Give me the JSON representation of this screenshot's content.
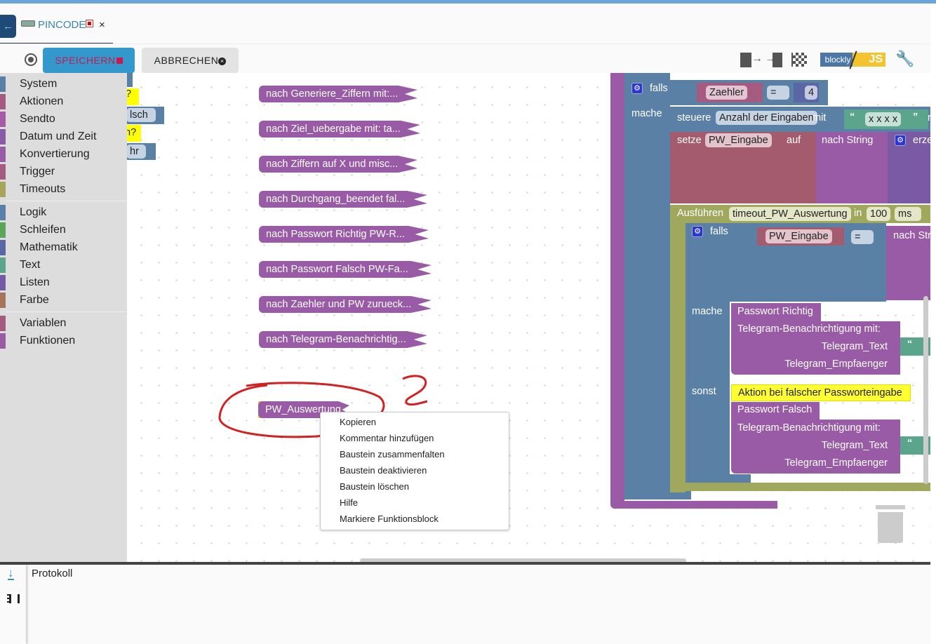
{
  "tab": {
    "title": "PINCODE",
    "close": "×",
    "logo": "blockly"
  },
  "toolbar": {
    "save_label": "SPEICHERN",
    "cancel_label": "ABBRECHEN",
    "mode_left": "blockly",
    "mode_right": "JS"
  },
  "toolbox": {
    "groups": [
      [
        {
          "label": "System",
          "color": "#5b80a5"
        },
        {
          "label": "Aktionen",
          "color": "#a55b80"
        },
        {
          "label": "Sendto",
          "color": "#a55ba5"
        },
        {
          "label": "Datum und Zeit",
          "color": "#8a5ba5"
        },
        {
          "label": "Konvertierung",
          "color": "#995ba5"
        },
        {
          "label": "Trigger",
          "color": "#a55b80"
        },
        {
          "label": "Timeouts",
          "color": "#a5a55b"
        }
      ],
      [
        {
          "label": "Logik",
          "color": "#5b80a5"
        },
        {
          "label": "Schleifen",
          "color": "#5ba55b"
        },
        {
          "label": "Mathematik",
          "color": "#5b67a5"
        },
        {
          "label": "Text",
          "color": "#5ba58c"
        },
        {
          "label": "Listen",
          "color": "#745ba5"
        },
        {
          "label": "Farbe",
          "color": "#a5745b"
        }
      ],
      [
        {
          "label": "Variablen",
          "color": "#a55b80"
        },
        {
          "label": "Funktionen",
          "color": "#995ba5"
        }
      ]
    ]
  },
  "partial_blocks": [
    "?",
    "lsch",
    "n?",
    "hr"
  ],
  "calls": [
    "nach Generiere_Ziffern mit:...",
    "nach Ziel_uebergabe mit: ta...",
    "nach Ziffern auf X und misc...",
    "nach Durchgang_beendet  fal...",
    "nach Passwort Richtig  PW-R...",
    "nach Passwort Falsch  PW-Fa...",
    "nach Zaehler und PW zurueck...",
    "nach Telegram-Benachrichtig..."
  ],
  "selected_block": "PW_Auswertung",
  "annotation": "?",
  "context_menu": [
    "Kopieren",
    "Kommentar hinzufügen",
    "Baustein zusammenfalten",
    "Baustein deaktivieren",
    "Baustein löschen",
    "Hilfe",
    "Markiere Funktionsblock"
  ],
  "code": {
    "falls": "falls",
    "mache": "mache",
    "sonst": "sonst",
    "var_zaehler": "Zaehler",
    "eq": "=",
    "num4": "4",
    "steuere": "steuere",
    "state": "Anzahl der Eingaben",
    "mit": "mit",
    "text_xxxx": "x x x x",
    "cut_r": "r",
    "setze": "setze",
    "var_pw": "PW_Eingabe",
    "auf": "auf",
    "nach_string": "nach String",
    "erze": "erze",
    "ausfuehren": "Ausführen",
    "timeout_name": "timeout_PW_Auswertung",
    "in": "in",
    "delay": "100",
    "unit": "ms",
    "nach_str": "nach Str",
    "pw_richtig": "Passwort Richtig",
    "telegram": "Telegram-Benachrichtigung  mit:",
    "tg_text": "Telegram_Text",
    "tg_empf": "Telegram_Empfaenger",
    "comment": "Aktion bei falscher Passworteingabe",
    "pw_falsch": "Passwort Falsch",
    "cut_a": "a"
  },
  "log": {
    "title": "Protokoll"
  }
}
